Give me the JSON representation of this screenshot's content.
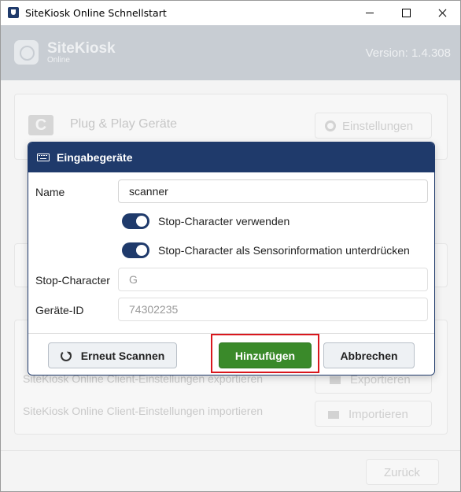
{
  "window": {
    "title": "SiteKiosk Online Schnellstart"
  },
  "app": {
    "logo_text": "SiteKiosk",
    "logo_sub": "Online",
    "version": "Version: 1.4.308",
    "plug_play_label": "Plug & Play Geräte",
    "settings_button": "Einstellungen",
    "export_label": "SiteKiosk Online Client-Einstellungen exportieren",
    "export_button": "Exportieren",
    "import_label": "SiteKiosk Online Client-Einstellungen importieren",
    "import_button": "Importieren",
    "back_button": "Zurück",
    "c_icon_letter": "C"
  },
  "dialog": {
    "title": "Eingabegeräte",
    "name_label": "Name",
    "name_value": "scanner",
    "toggle1_label": "Stop-Character verwenden",
    "toggle1_on": true,
    "toggle2_label": "Stop-Character als Sensorinformation unterdrücken",
    "toggle2_on": true,
    "stop_char_label": "Stop-Character",
    "stop_char_value": "G",
    "device_id_label": "Geräte-ID",
    "device_id_value": "74302235",
    "rescan_button": "Erneut Scannen",
    "add_button": "Hinzufügen",
    "cancel_button": "Abbrechen"
  },
  "colors": {
    "primary": "#1f3a6b",
    "add_button": "#3a8a2a",
    "highlight": "#d9171d"
  }
}
